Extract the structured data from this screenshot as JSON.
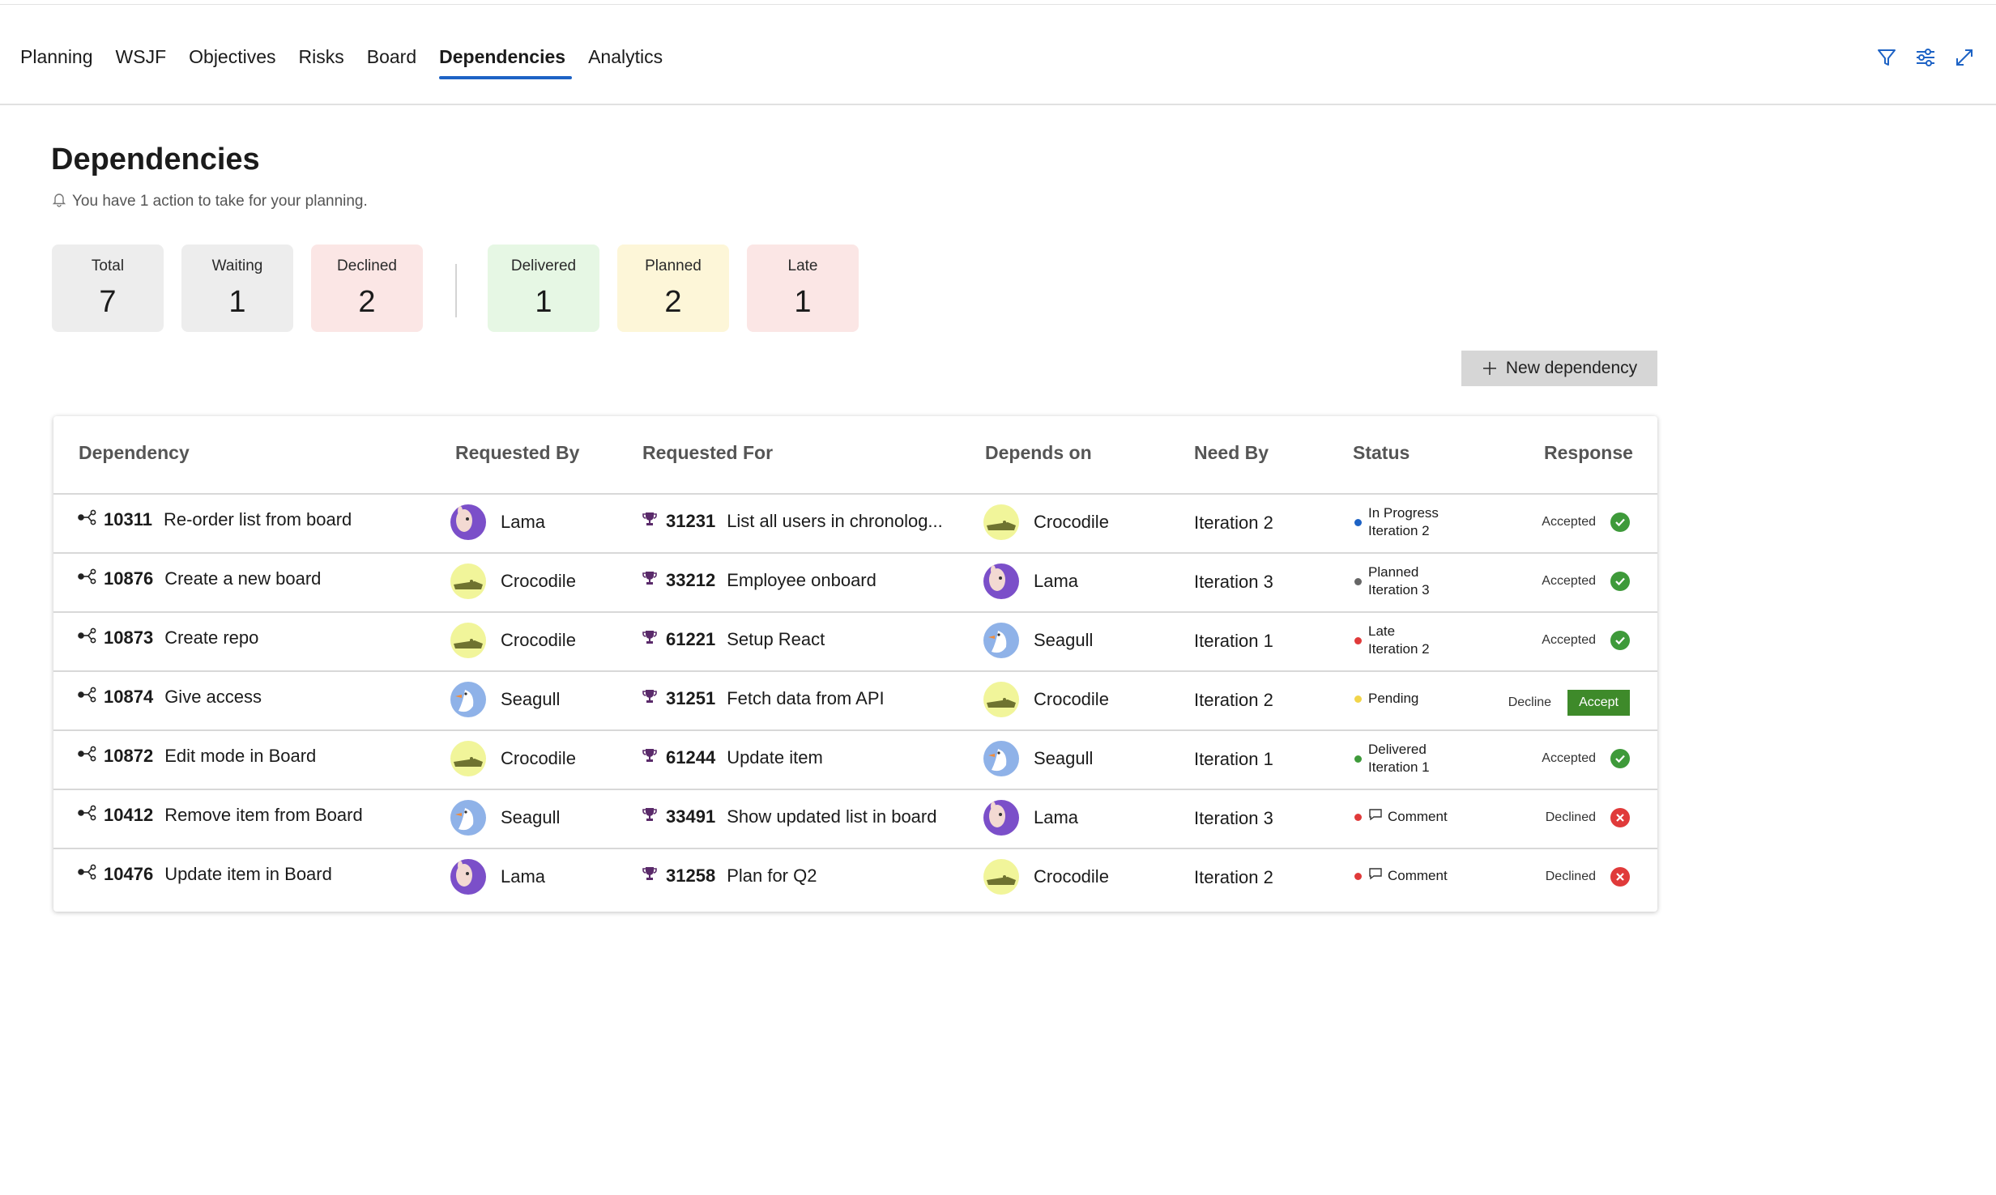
{
  "nav": {
    "tabs": [
      "Planning",
      "WSJF",
      "Objectives",
      "Risks",
      "Board",
      "Dependencies",
      "Analytics"
    ],
    "active_tab": "Dependencies",
    "icons": [
      "filter-icon",
      "settings-sliders-icon",
      "expand-icon"
    ]
  },
  "page": {
    "title": "Dependencies",
    "subtitle": "You have 1 action to take for your planning."
  },
  "summary_cards": [
    {
      "label": "Total",
      "value": "7",
      "color": "#ededed"
    },
    {
      "label": "Waiting",
      "value": "1",
      "color": "#ededed"
    },
    {
      "label": "Declined",
      "value": "2",
      "color": "#fbe6e5"
    },
    {
      "label": "Delivered",
      "value": "1",
      "color": "#e6f7e4"
    },
    {
      "label": "Planned",
      "value": "2",
      "color": "#fdf6d8"
    },
    {
      "label": "Late",
      "value": "1",
      "color": "#fbe6e5"
    }
  ],
  "new_dependency_label": "New dependency",
  "table": {
    "headers": [
      "Dependency",
      "Requested By",
      "Requested For",
      "Depends on",
      "Need By",
      "Status",
      "Response"
    ],
    "rows": [
      {
        "dep_id": "10311",
        "dep_title": "Re-order list from board",
        "req_by": "Lama",
        "req_by_avatar": "lama",
        "req_for_id": "31231",
        "req_for_title": "List all users in chronolog...",
        "depends_on": "Crocodile",
        "depends_avatar": "croc",
        "need_by": "Iteration 2",
        "status_line1": "In Progress",
        "status_line2": "Iteration 2",
        "status_color": "#1e63c5",
        "response": "Accepted",
        "response_kind": "ok"
      },
      {
        "dep_id": "10876",
        "dep_title": "Create a new board",
        "req_by": "Crocodile",
        "req_by_avatar": "croc",
        "req_for_id": "33212",
        "req_for_title": "Employee onboard",
        "depends_on": "Lama",
        "depends_avatar": "lama",
        "need_by": "Iteration 3",
        "status_line1": "Planned",
        "status_line2": "Iteration 3",
        "status_color": "#666666",
        "response": "Accepted",
        "response_kind": "ok"
      },
      {
        "dep_id": "10873",
        "dep_title": "Create repo",
        "req_by": "Crocodile",
        "req_by_avatar": "croc",
        "req_for_id": "61221",
        "req_for_title": "Setup React",
        "depends_on": "Seagull",
        "depends_avatar": "gull",
        "need_by": "Iteration 1",
        "status_line1": "Late",
        "status_line2": "Iteration 2",
        "status_color": "#e03a3a",
        "response": "Accepted",
        "response_kind": "ok"
      },
      {
        "dep_id": "10874",
        "dep_title": "Give access",
        "req_by": "Seagull",
        "req_by_avatar": "gull",
        "req_for_id": "31251",
        "req_for_title": "Fetch data from API",
        "depends_on": "Crocodile",
        "depends_avatar": "croc",
        "need_by": "Iteration 2",
        "status_line1": "Pending",
        "status_line2": "",
        "status_color": "#f2d54a",
        "response": "",
        "response_kind": "action",
        "decline_label": "Decline",
        "accept_label": "Accept"
      },
      {
        "dep_id": "10872",
        "dep_title": "Edit mode in Board",
        "req_by": "Crocodile",
        "req_by_avatar": "croc",
        "req_for_id": "61244",
        "req_for_title": "Update item",
        "depends_on": "Seagull",
        "depends_avatar": "gull",
        "need_by": "Iteration 1",
        "status_line1": "Delivered",
        "status_line2": "Iteration 1",
        "status_color": "#3e9a3a",
        "response": "Accepted",
        "response_kind": "ok"
      },
      {
        "dep_id": "10412",
        "dep_title": "Remove item from Board",
        "req_by": "Seagull",
        "req_by_avatar": "gull",
        "req_for_id": "33491",
        "req_for_title": "Show updated list in board",
        "depends_on": "Lama",
        "depends_avatar": "lama",
        "need_by": "Iteration 3",
        "status_line1": "Comment",
        "status_line2": "",
        "status_color": "#e03a3a",
        "status_comment": true,
        "response": "Declined",
        "response_kind": "bad"
      },
      {
        "dep_id": "10476",
        "dep_title": "Update item in Board",
        "req_by": "Lama",
        "req_by_avatar": "lama",
        "req_for_id": "31258",
        "req_for_title": "Plan for Q2",
        "depends_on": "Crocodile",
        "depends_avatar": "croc",
        "need_by": "Iteration 2",
        "status_line1": "Comment",
        "status_line2": "",
        "status_color": "#e03a3a",
        "status_comment": true,
        "response": "Declined",
        "response_kind": "bad"
      }
    ]
  }
}
